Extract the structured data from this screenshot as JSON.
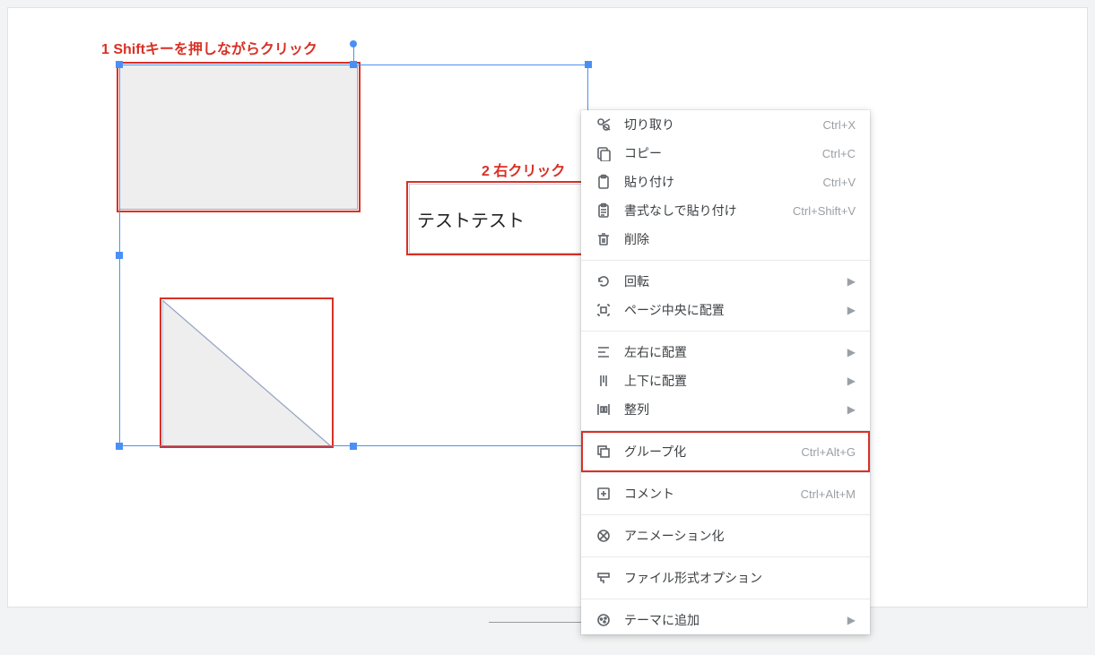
{
  "annotations": {
    "step1": "1 Shiftキーを押しながらクリック",
    "step2": "2 右クリック"
  },
  "textbox": {
    "content": "テストテスト"
  },
  "menu": {
    "sections": [
      [
        {
          "icon": "cut",
          "label": "切り取り",
          "shortcut": "Ctrl+X"
        },
        {
          "icon": "copy",
          "label": "コピー",
          "shortcut": "Ctrl+C"
        },
        {
          "icon": "paste",
          "label": "貼り付け",
          "shortcut": "Ctrl+V"
        },
        {
          "icon": "paste-plain",
          "label": "書式なしで貼り付け",
          "shortcut": "Ctrl+Shift+V"
        },
        {
          "icon": "delete",
          "label": "削除",
          "shortcut": ""
        }
      ],
      [
        {
          "icon": "rotate",
          "label": "回転",
          "arrow": true
        },
        {
          "icon": "center",
          "label": "ページ中央に配置",
          "arrow": true
        }
      ],
      [
        {
          "icon": "align-h",
          "label": "左右に配置",
          "arrow": true
        },
        {
          "icon": "align-v",
          "label": "上下に配置",
          "arrow": true
        },
        {
          "icon": "distribute",
          "label": "整列",
          "arrow": true
        }
      ],
      [
        {
          "icon": "group",
          "label": "グループ化",
          "shortcut": "Ctrl+Alt+G",
          "highlight": true
        }
      ],
      [
        {
          "icon": "comment",
          "label": "コメント",
          "shortcut": "Ctrl+Alt+M"
        }
      ],
      [
        {
          "icon": "animate",
          "label": "アニメーション化",
          "shortcut": ""
        }
      ],
      [
        {
          "icon": "format",
          "label": "ファイル形式オプション",
          "shortcut": ""
        }
      ],
      [
        {
          "icon": "theme",
          "label": "テーマに追加",
          "arrow": true
        }
      ]
    ]
  }
}
